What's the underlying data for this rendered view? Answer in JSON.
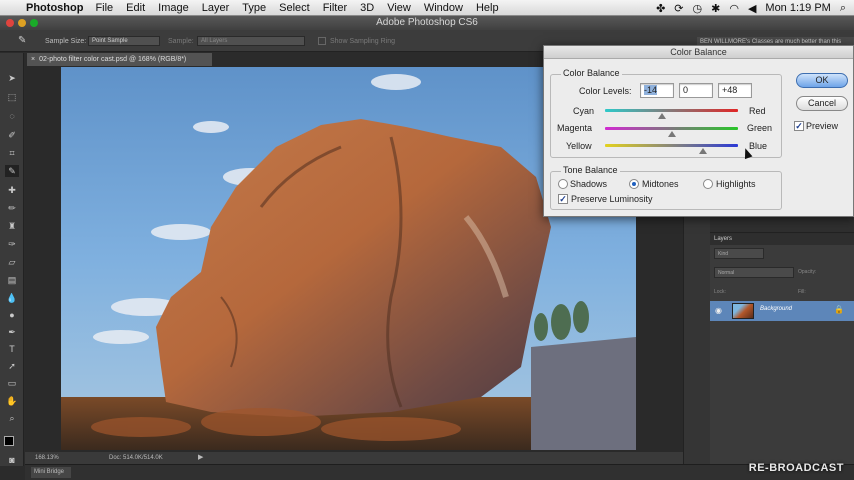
{
  "menubar": {
    "app_name": "Photoshop",
    "items": [
      "File",
      "Edit",
      "Image",
      "Layer",
      "Type",
      "Select",
      "Filter",
      "3D",
      "View",
      "Window",
      "Help"
    ],
    "clock": "Mon 1:19 PM"
  },
  "window": {
    "title": "Adobe Photoshop CS6"
  },
  "options_bar": {
    "sample_size_label": "Sample Size:",
    "sample_size_value": "Point Sample",
    "sample_label": "Sample:",
    "sample_value": "All Layers",
    "show_ring_label": "Show Sampling Ring",
    "info_text": "BEN WILLMORE's Classes are much better than this"
  },
  "document": {
    "tab_title": "02-photo filter color cast.psd @ 168% (RGB/8*)",
    "zoom": "168.13%",
    "doc_size": "Doc: 514.0K/514.0K"
  },
  "mini_bridge": {
    "label": "Mini Bridge"
  },
  "layers_panel": {
    "title": "Layers",
    "kind_label": "Kind",
    "blend_mode": "Normal",
    "opacity_label": "Opacity:",
    "lock_label": "Lock:",
    "fill_label": "Fill:",
    "layer_name": "Background"
  },
  "dialog": {
    "title": "Color Balance",
    "color_balance_group": "Color Balance",
    "color_levels_label": "Color Levels:",
    "levels": [
      "-14",
      "0",
      "+48"
    ],
    "sliders": [
      {
        "left": "Cyan",
        "right": "Red",
        "value": -14
      },
      {
        "left": "Magenta",
        "right": "Green",
        "value": 0
      },
      {
        "left": "Yellow",
        "right": "Blue",
        "value": 48
      }
    ],
    "tone_balance_group": "Tone Balance",
    "tones": [
      "Shadows",
      "Midtones",
      "Highlights"
    ],
    "selected_tone": "Midtones",
    "preserve_luminosity": "Preserve Luminosity",
    "ok": "OK",
    "cancel": "Cancel",
    "preview": "Preview"
  },
  "watermark": "RE-BROADCAST"
}
